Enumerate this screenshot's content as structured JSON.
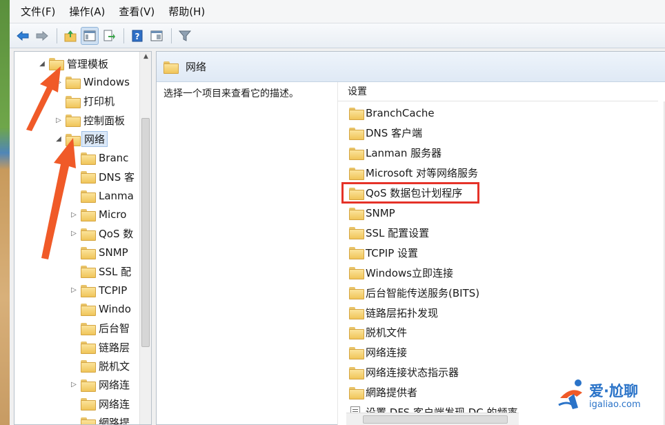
{
  "menu": [
    "文件(F)",
    "操作(A)",
    "查看(V)",
    "帮助(H)"
  ],
  "toolbar_icons": [
    "back-arrow-icon",
    "forward-arrow-icon",
    "up-folder-icon",
    "show-tree-icon",
    "export-list-icon",
    "help-icon",
    "properties-view-icon",
    "filter-icon"
  ],
  "tree": {
    "items": [
      {
        "label": "管理模板",
        "level": 0,
        "arrow": "expanded"
      },
      {
        "label": "Windows",
        "level": 1,
        "arrow": "collapsed"
      },
      {
        "label": "打印机",
        "level": 1,
        "arrow": "none"
      },
      {
        "label": "控制面板",
        "level": 1,
        "arrow": "collapsed"
      },
      {
        "label": "网络",
        "level": 1,
        "arrow": "expanded",
        "selected": true
      },
      {
        "label": "Branc",
        "level": 2,
        "arrow": "none"
      },
      {
        "label": "DNS 客",
        "level": 2,
        "arrow": "none"
      },
      {
        "label": "Lanma",
        "level": 2,
        "arrow": "none"
      },
      {
        "label": "Micro",
        "level": 2,
        "arrow": "collapsed"
      },
      {
        "label": "QoS 数",
        "level": 2,
        "arrow": "collapsed"
      },
      {
        "label": "SNMP",
        "level": 2,
        "arrow": "none"
      },
      {
        "label": "SSL 配",
        "level": 2,
        "arrow": "none"
      },
      {
        "label": "TCPIP",
        "level": 2,
        "arrow": "collapsed"
      },
      {
        "label": "Windo",
        "level": 2,
        "arrow": "none"
      },
      {
        "label": "后台智",
        "level": 2,
        "arrow": "none"
      },
      {
        "label": "链路层",
        "level": 2,
        "arrow": "none"
      },
      {
        "label": "脱机文",
        "level": 2,
        "arrow": "none"
      },
      {
        "label": "网络连",
        "level": 2,
        "arrow": "collapsed"
      },
      {
        "label": "网络连",
        "level": 2,
        "arrow": "none"
      },
      {
        "label": "網路提",
        "level": 2,
        "arrow": "none"
      }
    ]
  },
  "right": {
    "header_title": "网络",
    "description": "选择一个项目来查看它的描述。",
    "column_header": "设置",
    "settings": [
      {
        "label": "BranchCache",
        "icon": "folder-icon"
      },
      {
        "label": "DNS 客户端",
        "icon": "folder-icon"
      },
      {
        "label": "Lanman 服务器",
        "icon": "folder-icon"
      },
      {
        "label": "Microsoft 对等网络服务",
        "icon": "folder-icon"
      },
      {
        "label": "QoS 数据包计划程序",
        "icon": "folder-icon",
        "highlighted": true
      },
      {
        "label": "SNMP",
        "icon": "folder-icon"
      },
      {
        "label": "SSL 配置设置",
        "icon": "folder-icon"
      },
      {
        "label": "TCPIP 设置",
        "icon": "folder-icon"
      },
      {
        "label": "Windows立即连接",
        "icon": "folder-icon"
      },
      {
        "label": "后台智能传送服务(BITS)",
        "icon": "folder-icon"
      },
      {
        "label": "链路层拓扑发现",
        "icon": "folder-icon"
      },
      {
        "label": "脱机文件",
        "icon": "folder-icon"
      },
      {
        "label": "网络连接",
        "icon": "folder-icon"
      },
      {
        "label": "网络连接状态指示器",
        "icon": "folder-icon"
      },
      {
        "label": "網路提供者",
        "icon": "folder-icon"
      },
      {
        "label": "设置 DFS 客户端发现 DC 的频率",
        "icon": "policy-setting-icon"
      }
    ]
  },
  "annotation_color": "#f05a28",
  "highlight_color": "#e53228",
  "watermark": {
    "title": "爱·尬聊",
    "url": "igaliao.com",
    "color": "#2a73c8"
  }
}
